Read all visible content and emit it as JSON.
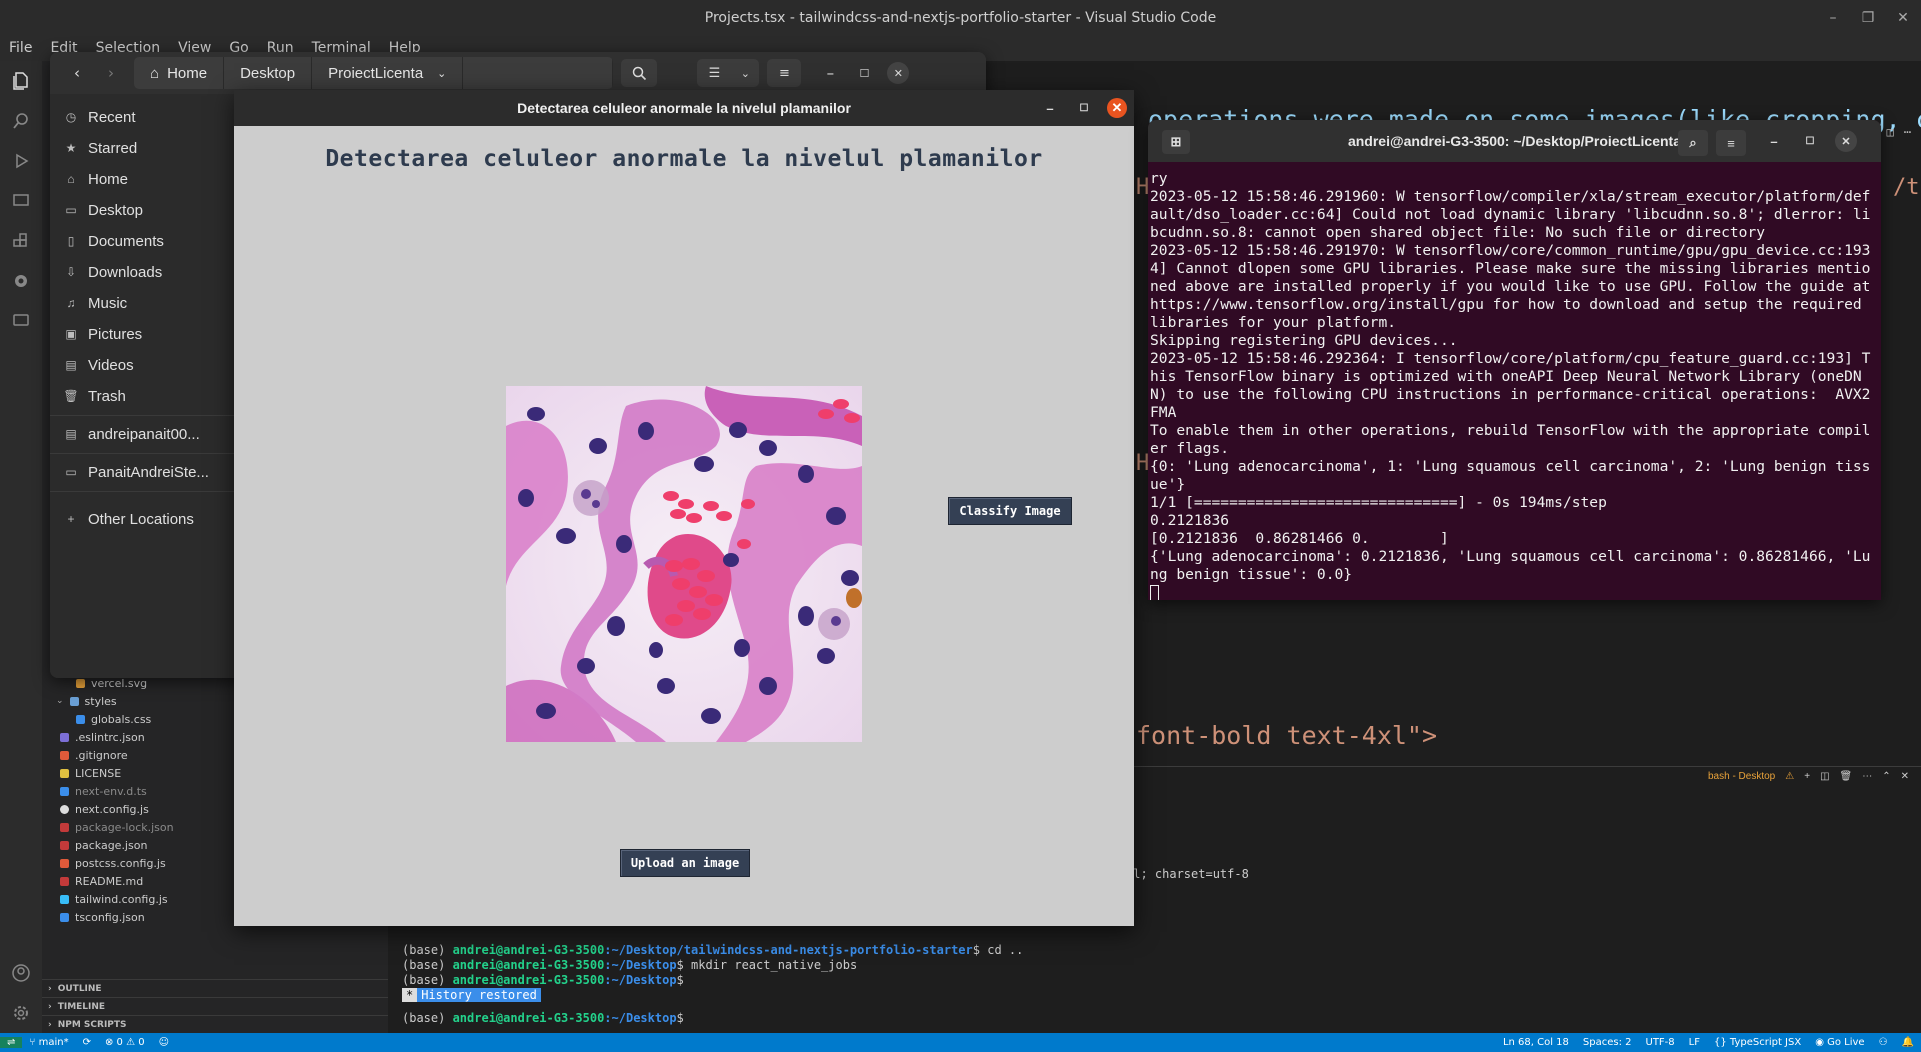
{
  "vscode": {
    "title": "Projects.tsx - tailwindcss-and-nextjs-portfolio-starter - Visual Studio Code",
    "menu": [
      "File",
      "Edit",
      "Selection",
      "View",
      "Go",
      "Run",
      "Terminal",
      "Help"
    ],
    "explorer_files": [
      {
        "name": "vercel.svg",
        "color": "#e8a23a"
      },
      {
        "name": "styles",
        "color": "#6a9fd4"
      },
      {
        "name": "globals.css",
        "color": "#3b8eea"
      },
      {
        "name": ".eslintrc.json",
        "color": "#7c6fd6"
      },
      {
        "name": ".gitignore",
        "color": "#e05a3a"
      },
      {
        "name": "LICENSE",
        "color": "#e0c040"
      },
      {
        "name": "next-env.d.ts",
        "color": "#3b8eea"
      },
      {
        "name": "next.config.js",
        "color": "#dddddd"
      },
      {
        "name": "package-lock.json",
        "color": "#c23a3a"
      },
      {
        "name": "package.json",
        "color": "#c23a3a"
      },
      {
        "name": "postcss.config.js",
        "color": "#e05a3a"
      },
      {
        "name": "README.md",
        "color": "#c23a3a"
      },
      {
        "name": "tailwind.config.js",
        "color": "#38bdf8"
      },
      {
        "name": "tsconfig.json",
        "color": "#3b8eea"
      }
    ],
    "sections": [
      "OUTLINE",
      "TIMELINE",
      "NPM SCRIPTS"
    ],
    "editor_lines": [
      {
        "text": "operations were made on some images(like cropping, c"
      },
      {
        "text": "H"
      },
      {
        "text": "/t"
      },
      {
        "text": "H"
      },
      {
        "text": "font-bold text-4xl\">"
      }
    ],
    "panel_status": "nl; charset=utf-8",
    "panel_tab": "bash - Desktop",
    "terminal": {
      "prompt_user": "andrei@andrei-G3-3500",
      "lines": [
        {
          "prefix": "(base) ",
          "path": ":~/Desktop/tailwindcss-and-nextjs-portfolio-starter",
          "cmd": "$ cd .."
        },
        {
          "prefix": "(base) ",
          "path": ":~/Desktop",
          "cmd": "$ mkdir react_native_jobs"
        },
        {
          "prefix": "(base) ",
          "path": ":~/Desktop",
          "cmd": "$"
        },
        {
          "prefix": "(base) ",
          "path": ":~/Desktop",
          "cmd": "$"
        }
      ],
      "history_restored": "History restored"
    },
    "statusbar": {
      "branch": "main*",
      "problems": "⊗ 0 ⚠ 0",
      "position": "Ln 68, Col 18",
      "spaces": "Spaces: 2",
      "encoding": "UTF-8",
      "eol": "LF",
      "language": "TypeScript JSX",
      "golive": "Go Live"
    }
  },
  "files": {
    "back_icon": "chevron-left-icon",
    "breadcrumbs": [
      "Home",
      "Desktop",
      "ProiectLicenta"
    ],
    "sidebar": [
      {
        "label": "Recent",
        "icon": "clock-icon"
      },
      {
        "label": "Starred",
        "icon": "star-icon"
      },
      {
        "label": "Home",
        "icon": "home-icon"
      },
      {
        "label": "Desktop",
        "icon": "desktop-icon"
      },
      {
        "label": "Documents",
        "icon": "document-icon"
      },
      {
        "label": "Downloads",
        "icon": "download-icon"
      },
      {
        "label": "Music",
        "icon": "music-icon"
      },
      {
        "label": "Pictures",
        "icon": "picture-icon"
      },
      {
        "label": "Videos",
        "icon": "video-icon"
      },
      {
        "label": "Trash",
        "icon": "trash-icon"
      },
      {
        "label": "andreipanait00...",
        "icon": "drive-icon"
      },
      {
        "label": "PanaitAndreiSte...",
        "icon": "folder-icon"
      },
      {
        "label": "Other Locations",
        "icon": "plus-icon"
      }
    ]
  },
  "app": {
    "window_title": "Detectarea celuleor anormale la nivelul plamanilor",
    "heading": "Detectarea celuleor anormale la nivelul plamanilor",
    "classify_label": "Classify Image",
    "upload_label": "Upload an image",
    "image_desc": "H&E stained lung tissue micrograph"
  },
  "terminal": {
    "title": "andrei@andrei-G3-3500: ~/Desktop/ProiectLicenta",
    "output": "ry\n2023-05-12 15:58:46.291960: W tensorflow/compiler/xla/stream_executor/platform/default/dso_loader.cc:64] Could not load dynamic library 'libcudnn.so.8'; dlerror: libcudnn.so.8: cannot open shared object file: No such file or directory\n2023-05-12 15:58:46.291970: W tensorflow/core/common_runtime/gpu/gpu_device.cc:1934] Cannot dlopen some GPU libraries. Please make sure the missing libraries mentioned above are installed properly if you would like to use GPU. Follow the guide at https://www.tensorflow.org/install/gpu for how to download and setup the required libraries for your platform.\nSkipping registering GPU devices...\n2023-05-12 15:58:46.292364: I tensorflow/core/platform/cpu_feature_guard.cc:193] This TensorFlow binary is optimized with oneAPI Deep Neural Network Library (oneDNN) to use the following CPU instructions in performance-critical operations:  AVX2 FMA\nTo enable them in other operations, rebuild TensorFlow with the appropriate compiler flags.\n{0: 'Lung adenocarcinoma', 1: 'Lung squamous cell carcinoma', 2: 'Lung benign tissue'}\n1/1 [==============================] - 0s 194ms/step\n0.2121836\n[0.2121836  0.86281466 0.        ]\n{'Lung adenocarcinoma': 0.2121836, 'Lung squamous cell carcinoma': 0.86281466, 'Lung benign tissue': 0.0}\n"
  }
}
